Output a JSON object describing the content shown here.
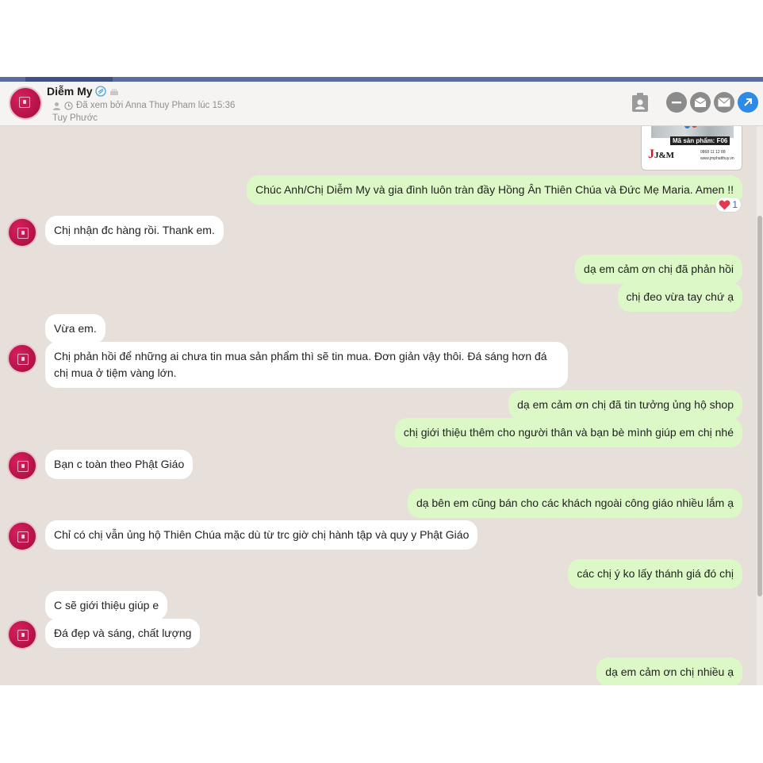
{
  "header": {
    "contact_name": "Diễm My",
    "seen_status": "Đã xem bởi Anna Thuy Pham lúc 15:36",
    "location": "Tuy Phước",
    "icons": [
      "clipboard-icon",
      "minimize-icon",
      "message-icon",
      "email-icon",
      "share-icon"
    ]
  },
  "product_image": {
    "code_label": "Mã sản phẩm: F06",
    "brand": "J&M",
    "contact_line_1": "0868 11 12 88",
    "contact_line_2": "www.jmphatthuy.vn"
  },
  "reaction": {
    "icon": "heart-icon",
    "count": "1"
  },
  "messages": [
    {
      "dir": "out",
      "text": "Chúc Anh/Chị Diễm My và gia đình luôn tràn đầy Hồng Ân Thiên Chúa và Đức Mẹ Maria. Amen !!"
    },
    {
      "dir": "in",
      "text": "Chị nhận đc hàng rồi. Thank em."
    },
    {
      "dir": "out",
      "text": "dạ em cảm ơn chị đã phản hồi"
    },
    {
      "dir": "out",
      "text": "chị đeo vừa tay chứ ạ"
    },
    {
      "dir": "in",
      "text": "Vừa em."
    },
    {
      "dir": "in",
      "text": "Chị phản hồi để những ai chưa tin mua sản phẩm thì sẽ tin mua. Đơn giản vậy thôi. Đá sáng hơn đá chị mua ở tiệm vàng lớn."
    },
    {
      "dir": "out",
      "text": "dạ em cảm ơn chị đã tin tưởng ủng hộ shop"
    },
    {
      "dir": "out",
      "text": "chị giới thiệu thêm cho người thân và bạn bè mình giúp em chị nhé"
    },
    {
      "dir": "in",
      "text": "Bạn c toàn theo Phật Giáo"
    },
    {
      "dir": "out",
      "text": "dạ bên em cũng bán cho các khách ngoài công giáo nhiều lắm ạ"
    },
    {
      "dir": "in",
      "text": "Chỉ có chị vẫn ủng hộ Thiên Chúa mặc dù từ trc giờ chị hành tập và quy y Phật Giáo"
    },
    {
      "dir": "out",
      "text": "các chị ý ko lấy thánh giá đó chị"
    },
    {
      "dir": "in",
      "text": "C sẽ giới thiệu giúp e"
    },
    {
      "dir": "in",
      "text": "Đá đẹp và sáng, chất lượng"
    },
    {
      "dir": "out",
      "text": "dạ em cảm ơn chị nhiều ạ"
    }
  ],
  "colors": {
    "chat_background": "#e6dfda",
    "outgoing_bubble": "#dcf8c6",
    "incoming_bubble": "#ffffff",
    "accent_blue": "#2d8ae6",
    "avatar_pink": "#c8154c"
  }
}
